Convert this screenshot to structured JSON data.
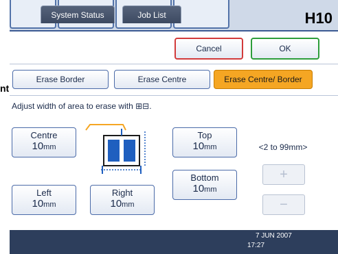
{
  "edge_label": "nt",
  "header": {
    "code": "H10"
  },
  "actions": {
    "cancel_label": "Cancel",
    "ok_label": "OK"
  },
  "modes": [
    {
      "label": "Erase Border",
      "selected": false
    },
    {
      "label": "Erase Centre",
      "selected": false
    },
    {
      "label": "Erase Centre/ Border",
      "selected": true
    }
  ],
  "instruction": "Adjust width of area to erase with ⊞⊟.",
  "fields": {
    "centre": {
      "label": "Centre",
      "value": "10",
      "unit": "mm"
    },
    "top": {
      "label": "Top",
      "value": "10",
      "unit": "mm"
    },
    "bottom": {
      "label": "Bottom",
      "value": "10",
      "unit": "mm"
    },
    "left": {
      "label": "Left",
      "value": "10",
      "unit": "mm"
    },
    "right": {
      "label": "Right",
      "value": "10",
      "unit": "mm"
    }
  },
  "range": "<2 to 99mm>",
  "stepper": {
    "plus_label": "+",
    "minus_label": "−"
  },
  "footer": {
    "system_status_label": "System Status",
    "job_list_label": "Job List",
    "date": "7 JUN  2007",
    "time": "17:27"
  },
  "colors": {
    "selected_tab": "#f5a623",
    "cancel_border": "#d23a3a",
    "ok_border": "#2c9d3a",
    "bottom_bar": "#2d3e5c"
  }
}
